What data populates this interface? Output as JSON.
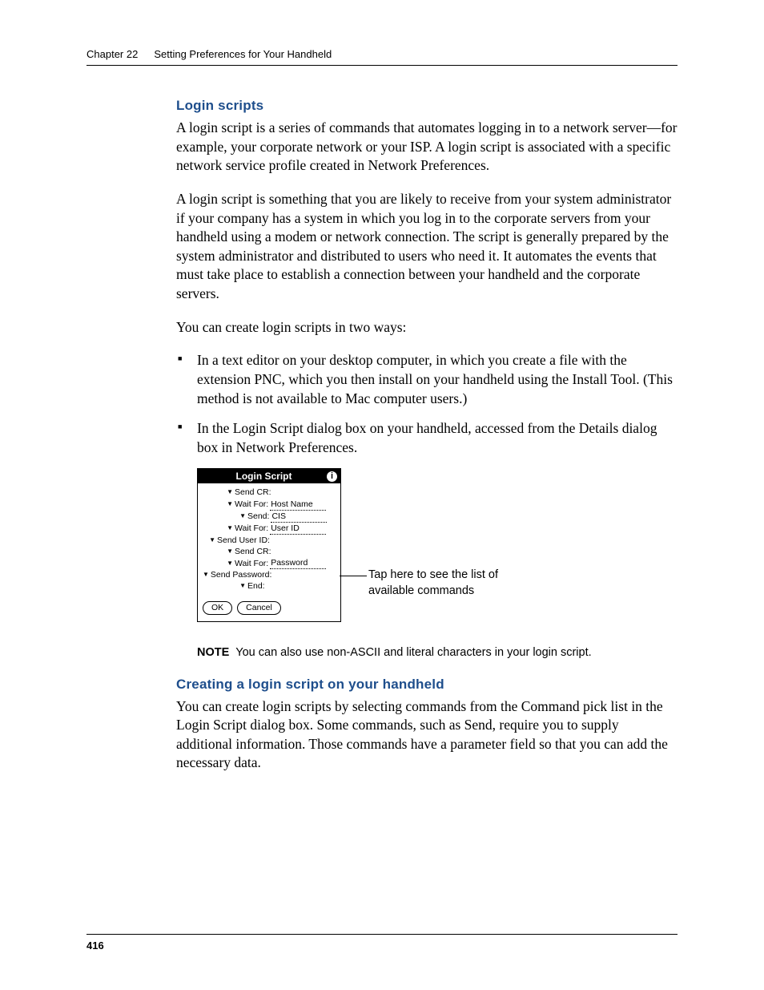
{
  "header": {
    "chapter": "Chapter 22",
    "title": "Setting Preferences for Your Handheld"
  },
  "section1": {
    "heading": "Login scripts",
    "p1": "A login script is a series of commands that automates logging in to a network server—for example, your corporate network or your ISP. A login script is associated with a specific network service profile created in Network Preferences.",
    "p2": "A login script is something that you are likely to receive from your system administrator if your company has a system in which you log in to the corporate servers from your handheld using a modem or network connection. The script is generally prepared by the system administrator and distributed to users who need it. It automates the events that must take place to establish a connection between your handheld and the corporate servers.",
    "p3": "You can create login scripts in two ways:",
    "li1": "In a text editor on your desktop computer, in which you create a file with the extension PNC, which you then install on your handheld using the Install Tool. (This method is not available to Mac computer users.)",
    "li2": "In the Login Script dialog box on your handheld, accessed from the Details dialog box in Network Preferences."
  },
  "device": {
    "title": "Login Script",
    "rows": {
      "r1": "Send CR:",
      "r2l": "Wait For:",
      "r2v": "Host Name",
      "r3l": "Send:",
      "r3v": "CIS",
      "r4l": "Wait For:",
      "r4v": "User ID",
      "r5": "Send User ID:",
      "r6": "Send CR:",
      "r7l": "Wait For:",
      "r7v": "Password",
      "r8": "Send Password:",
      "r9": "End:"
    },
    "ok": "OK",
    "cancel": "Cancel"
  },
  "callout": {
    "line1": "Tap here to see the list of",
    "line2": "available commands"
  },
  "note": {
    "label": "NOTE",
    "text": "You can also use non-ASCII and literal characters in your login script."
  },
  "section2": {
    "heading": "Creating a login script on your handheld",
    "p1": "You can create login scripts by selecting commands from the Command pick list in the Login Script dialog box. Some commands, such as Send, require you to supply additional information. Those commands have a parameter field so that you can add the necessary data."
  },
  "pageNumber": "416"
}
